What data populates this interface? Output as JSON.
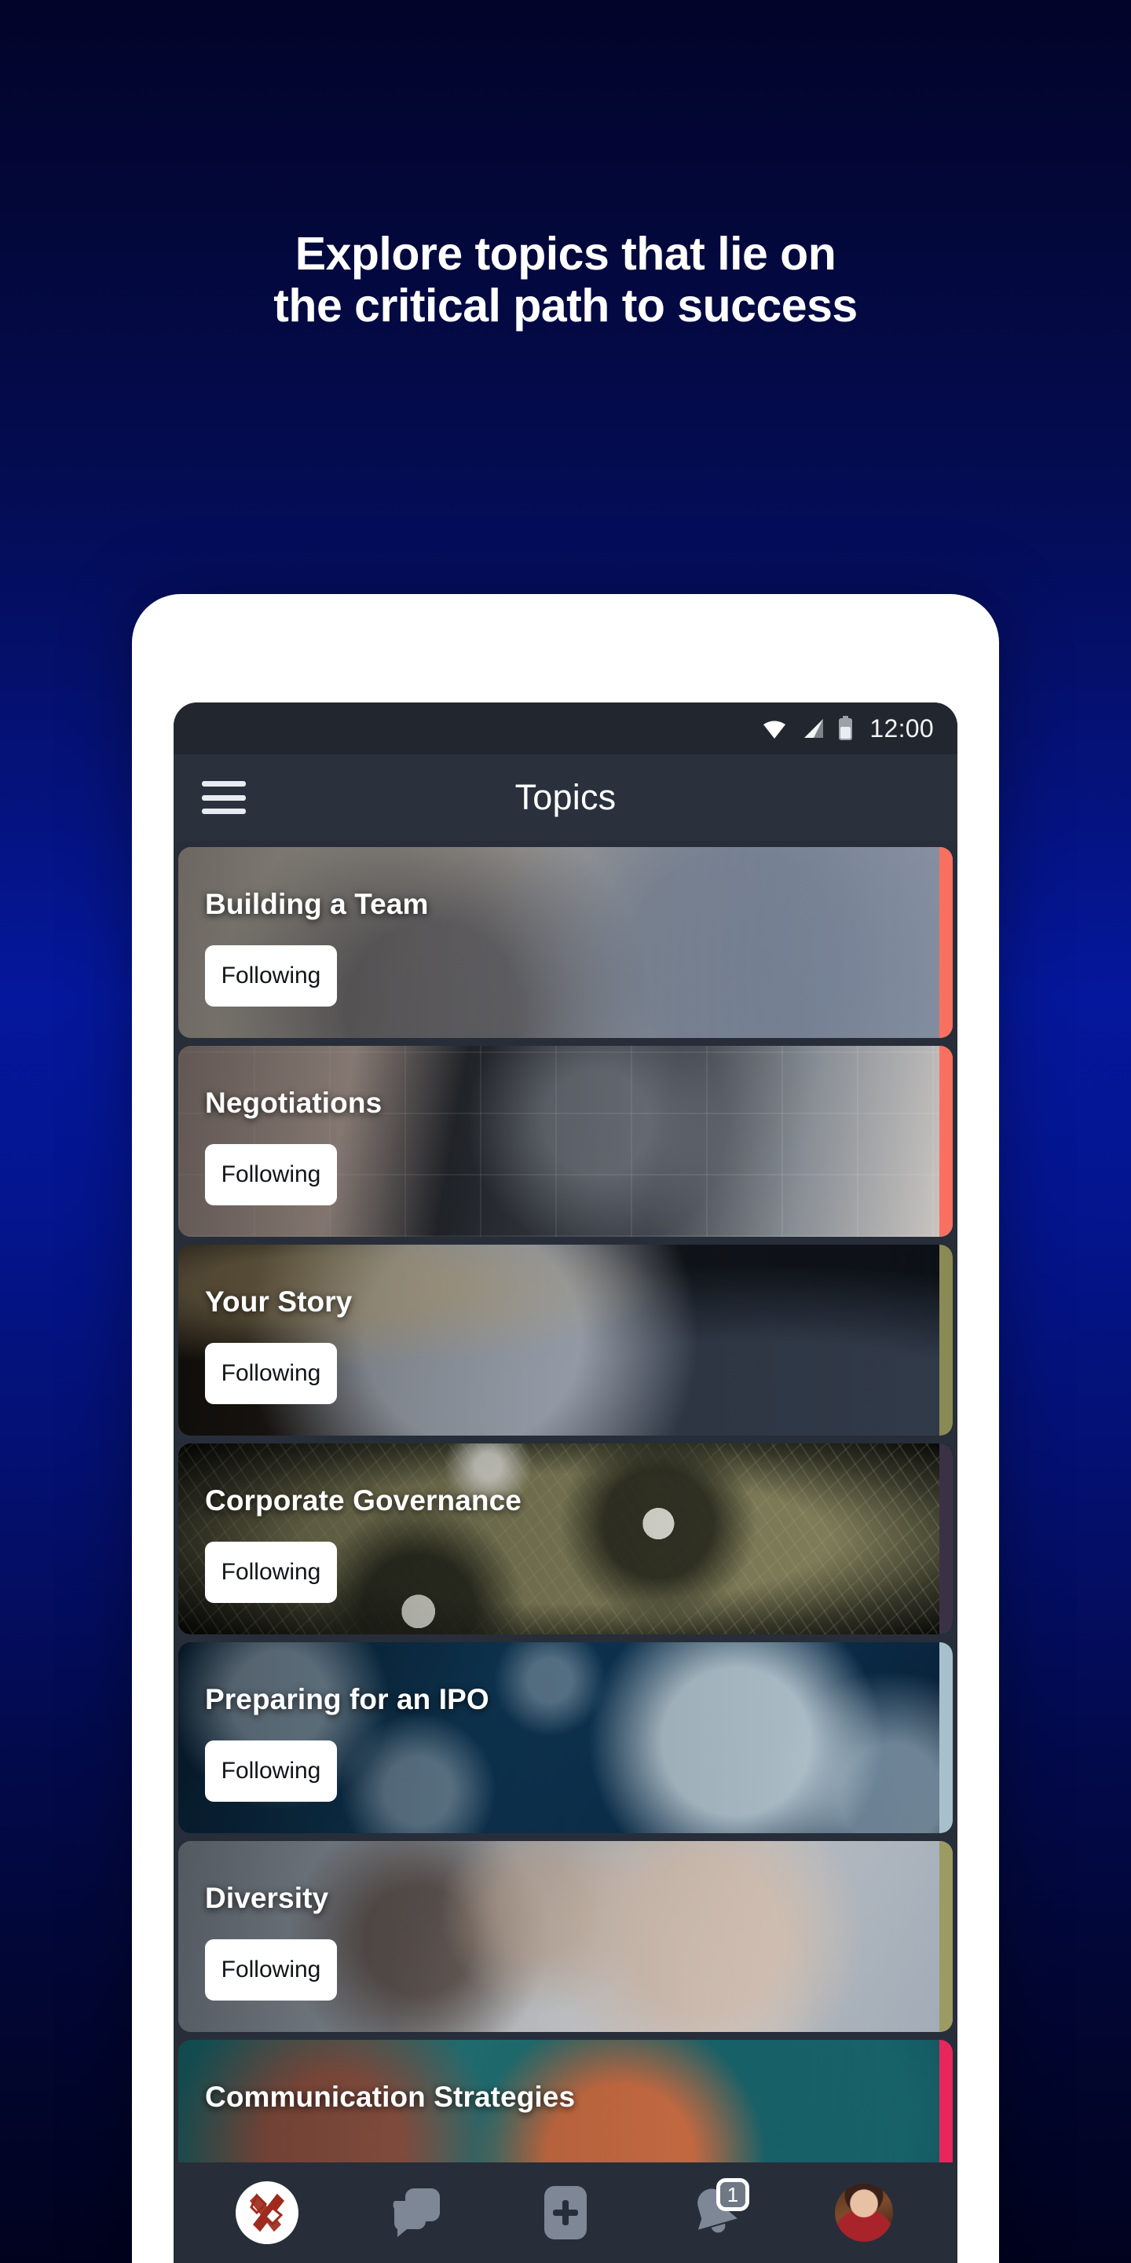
{
  "headline": {
    "line1": "Explore topics that lie on",
    "line2": "the critical path to success"
  },
  "phone": {
    "status_bar": {
      "time": "12:00",
      "icons": [
        "wifi-icon",
        "cellular-signal-icon",
        "battery-icon"
      ]
    },
    "app_bar": {
      "menu_icon": "hamburger-menu-icon",
      "title": "Topics"
    },
    "topics": [
      {
        "title": "Building a Team",
        "button": "Following",
        "accent": "#f97060",
        "media": "m-team"
      },
      {
        "title": "Negotiations",
        "button": "Following",
        "accent": "#f97060",
        "media": "m-negotiations"
      },
      {
        "title": "Your Story",
        "button": "Following",
        "accent": "#8a8a55",
        "media": "m-story"
      },
      {
        "title": "Corporate Governance",
        "button": "Following",
        "accent": "#3b3147",
        "media": "m-governance"
      },
      {
        "title": "Preparing for an IPO",
        "button": "Following",
        "accent": "#a8c0cc",
        "media": "m-ipo"
      },
      {
        "title": "Diversity",
        "button": "Following",
        "accent": "#9b9b63",
        "media": "m-diversity"
      },
      {
        "title": "Communication Strategies",
        "button": "",
        "accent": "#e8265c",
        "media": "m-comms"
      }
    ],
    "bottom_nav": [
      {
        "name": "home-logo",
        "icon": "ribbon-x-logo-icon",
        "badge": ""
      },
      {
        "name": "messages",
        "icon": "chat-bubbles-icon",
        "badge": ""
      },
      {
        "name": "create",
        "icon": "plus-add-icon",
        "badge": ""
      },
      {
        "name": "notifications",
        "icon": "bell-icon",
        "badge": "1"
      },
      {
        "name": "profile",
        "icon": "avatar-icon",
        "badge": ""
      }
    ]
  },
  "colors": {
    "background_top": "#02042a",
    "background_mid": "#05179c",
    "background_bottom": "#01031e",
    "app_bar": "#2a313c",
    "status_bar": "#22272f",
    "screen": "#272e39",
    "logo_red": "#9e2b1d",
    "button_bg": "#ffffff"
  }
}
